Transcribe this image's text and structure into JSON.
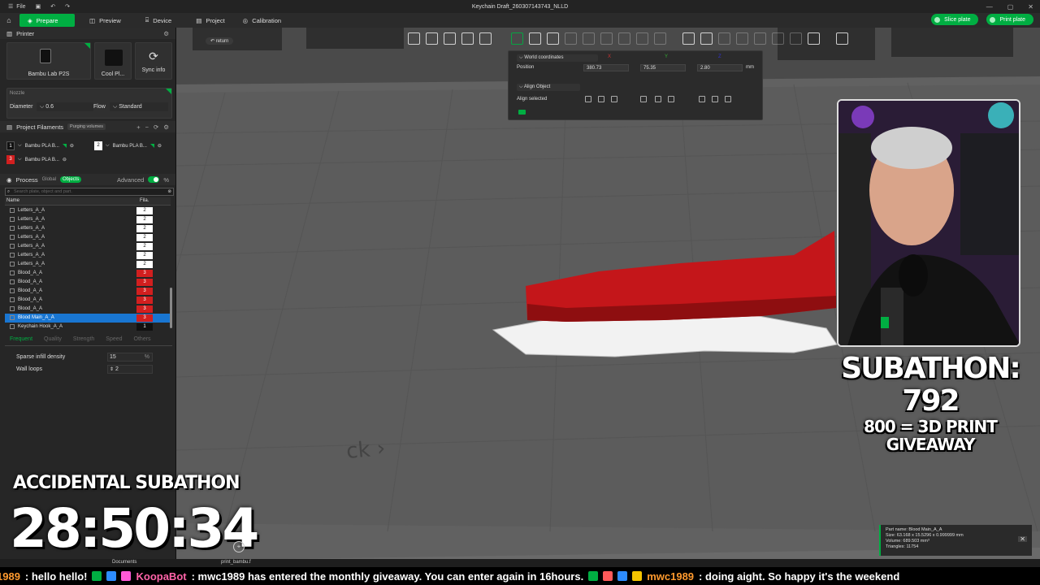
{
  "window_title": "Keychain Draft_260307143743_NLLD",
  "file_menu": "File",
  "tabs": [
    "Prepare",
    "Preview",
    "Device",
    "Project",
    "Calibration"
  ],
  "top_actions": {
    "slice": "Slice plate",
    "print": "Print plate"
  },
  "printer": {
    "header": "Printer",
    "name": "Bambu Lab P2S",
    "plate": "Cool Pl...",
    "sync": "Sync info",
    "nozzle_label": "Nozzle",
    "diameter_label": "Diameter",
    "diameter_value": "0.6",
    "flow_label": "Flow",
    "flow_value": "Standard"
  },
  "filaments": {
    "header": "Project Filaments",
    "purge_btn": "Purging volumes",
    "items": [
      {
        "num": "1",
        "name": "Bambu PLA B...",
        "color": "#111111"
      },
      {
        "num": "2",
        "name": "Bambu PLA B...",
        "color": "#ffffff"
      },
      {
        "num": "3",
        "name": "Bambu PLA B...",
        "color": "#d21f1f"
      }
    ]
  },
  "process": {
    "header": "Process",
    "global": "Global",
    "objects": "Objects",
    "advanced": "Advanced",
    "search_placeholder": "Search plate, object and part."
  },
  "object_list": {
    "col_name": "Name",
    "col_fila": "Fila.",
    "rows": [
      {
        "name": "Letters_A_A",
        "fila": "2"
      },
      {
        "name": "Letters_A_A",
        "fila": "2"
      },
      {
        "name": "Letters_A_A",
        "fila": "2"
      },
      {
        "name": "Letters_A_A",
        "fila": "2"
      },
      {
        "name": "Letters_A_A",
        "fila": "2"
      },
      {
        "name": "Letters_A_A",
        "fila": "2"
      },
      {
        "name": "Letters_A_A",
        "fila": "2"
      },
      {
        "name": "Blood_A_A",
        "fila": "3"
      },
      {
        "name": "Blood_A_A",
        "fila": "3"
      },
      {
        "name": "Blood_A_A",
        "fila": "3"
      },
      {
        "name": "Blood_A_A",
        "fila": "3"
      },
      {
        "name": "Blood_A_A",
        "fila": "3"
      },
      {
        "name": "Blood Main_A_A",
        "fila": "3",
        "selected": true
      },
      {
        "name": "Keychain Hook_A_A",
        "fila": "1"
      }
    ]
  },
  "settings_tabs": [
    "Frequent",
    "Quality",
    "Strength",
    "Speed",
    "Others"
  ],
  "settings": {
    "infill_label": "Sparse infill density",
    "infill_value": "15",
    "infill_unit": "%",
    "walls_label": "Wall loops",
    "walls_value": "2"
  },
  "viewport": {
    "return": "return",
    "world_coords": "World coordinates",
    "position": "Position",
    "axes": [
      "X",
      "Y",
      "Z"
    ],
    "pos_x": "380.73",
    "pos_y": "75.35",
    "pos_z": "2.80",
    "unit": "mm",
    "align_object": "Align Object",
    "align_selected": "Align selected"
  },
  "part_info": {
    "name": "Part name:  Blood Main_A_A",
    "size": "Size: 63.168 x 15.5296 x 0.999999 mm",
    "volume": "Volume: 689.503 mm³",
    "triangles": "Triangles: 11754"
  },
  "overlay": {
    "subathon": "SUBATHON: 792",
    "giveaway": "800 = 3D PRINT GIVEAWAY",
    "accidental": "ACCIDENTAL SUBATHON",
    "timer": "28:50:34"
  },
  "taskbar": {
    "docs": "Documents",
    "file": "print_bambu.f"
  },
  "ticker": {
    "u0": "1989",
    "m0": ": hello hello!",
    "u1": "KoopaBot",
    "m1": ": mwc1989 has entered the monthly giveaway. You can enter again in 16hours.",
    "u2": "mwc1989",
    "m2": ": doing aight. So happy it's the weekend"
  },
  "colors": {
    "accent": "#00ae42",
    "red": "#d21f1f"
  }
}
